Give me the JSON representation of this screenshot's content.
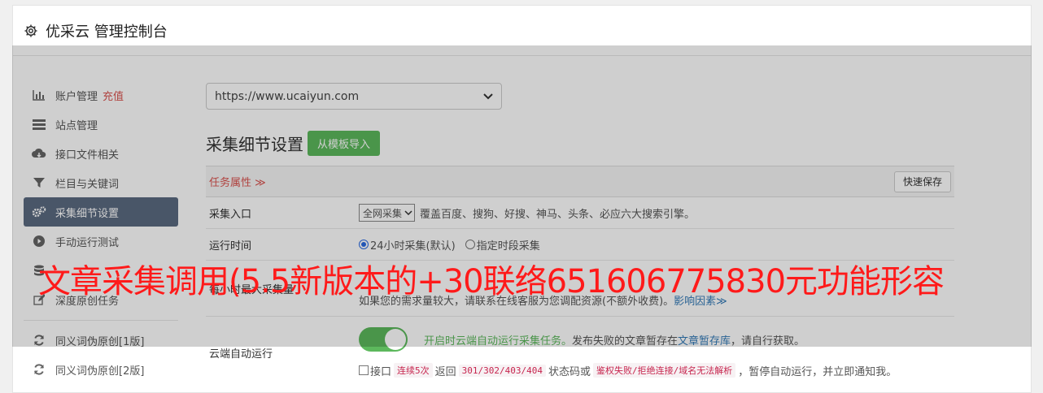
{
  "header": {
    "title": "优采云 管理控制台",
    "icon": "gear-icon"
  },
  "sidebar": {
    "items": [
      {
        "label": "账户管理",
        "extra": "充值",
        "icon": "bar-chart-icon"
      },
      {
        "label": "站点管理",
        "icon": "server-icon"
      },
      {
        "label": "接口文件相关",
        "icon": "cloud-download-icon"
      },
      {
        "label": "栏目与关键词",
        "icon": "filter-icon"
      },
      {
        "label": "采集细节设置",
        "icon": "cogs-icon",
        "active": true
      },
      {
        "label": "手动运行测试",
        "icon": "play-circle-icon"
      },
      {
        "label": "",
        "icon": "database-icon"
      },
      {
        "label": "深度原创任务",
        "icon": "edit-icon"
      },
      {
        "label": "同义词伪原创[1版]",
        "icon": "refresh-icon"
      },
      {
        "label": "同义词伪原创[2版]",
        "icon": "refresh-icon"
      }
    ]
  },
  "main": {
    "site_select": "https://www.ucaiyun.com",
    "section_title": "采集细节设置",
    "import_button": "从模板导入",
    "task_props_label": "任务属性 ≫",
    "quick_save_button": "快速保存",
    "rows": {
      "entry": {
        "label": "采集入口",
        "select_value": "全网采集",
        "desc": "覆盖百度、搜狗、好搜、神马、头条、必应六大搜索引擎。"
      },
      "runtime": {
        "label": "运行时间",
        "option1": "24小时采集(默认)",
        "option2": "指定时段采集"
      },
      "max": {
        "label": "每小时最大采集量",
        "line2_prefix": "如果您的需求量较大，请联系在线客服为您调配资源(不额外收费)。",
        "line2_link": "影响因素"
      },
      "cloud": {
        "label": "云端自动运行",
        "on_text": "开启时云端自动运行采集任务。",
        "desc_text": "发布失败的文章暂存在",
        "repo_link": "文章暂存库",
        "desc_tail": "，请自行获取。",
        "interface_label": "接口",
        "code1": "连续5次",
        "mid1": "返回",
        "code2": "301/302/403/404",
        "mid2": "状态码或",
        "code3": "鉴权失败/拒绝连接/域名无法解析",
        "tail": "，暂停自动运行，并立即通知我。"
      }
    }
  },
  "watermark": "文章采集调用(5.5新版本的+30联络651606775830元功能形容",
  "colors": {
    "active_bg": "#5b6a80",
    "green": "#5cb85c",
    "accent_red": "#d9534f",
    "link": "#337ab7"
  }
}
